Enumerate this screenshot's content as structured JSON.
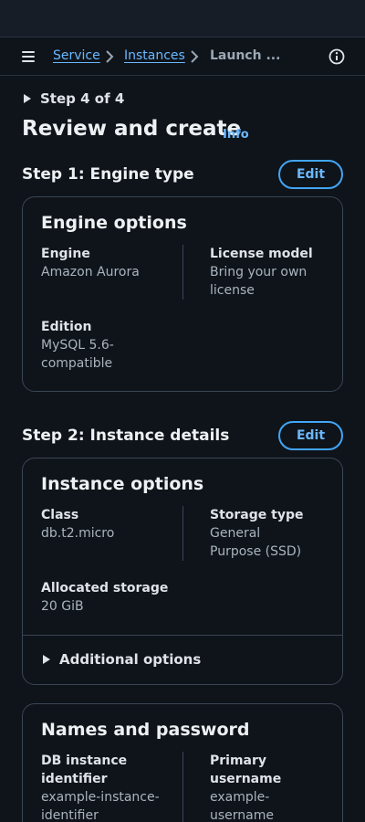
{
  "breadcrumb": {
    "items": [
      "Service",
      "Instances"
    ],
    "current": "Launch ..."
  },
  "wizard": {
    "step_indicator": "Step 4 of 4",
    "title": "Review and create",
    "info_link": "Info"
  },
  "sections": [
    {
      "heading": "Step 1: Engine type",
      "edit_label": "Edit",
      "card_title": "Engine options",
      "fields": [
        {
          "label": "Engine",
          "value": "Amazon Aurora"
        },
        {
          "label": "License model",
          "value": "Bring your own license"
        },
        {
          "label": "Edition",
          "value": "MySQL 5.6-compatible"
        }
      ]
    },
    {
      "heading": "Step 2: Instance details",
      "edit_label": "Edit",
      "card_title": "Instance options",
      "fields": [
        {
          "label": "Class",
          "value": "db.t2.micro"
        },
        {
          "label": "Storage type",
          "value": "General Purpose (SSD)"
        },
        {
          "label": "Allocated storage",
          "value": "20 GiB"
        }
      ],
      "expandable": "Additional options"
    }
  ],
  "names_card": {
    "title": "Names and password",
    "fields": [
      {
        "label": "DB instance identifier",
        "value": "example-instance-identifier"
      },
      {
        "label": "Primary username",
        "value": "example-username"
      }
    ]
  },
  "colors": {
    "background": "#0f141a",
    "link": "#6ab8ff",
    "border": "#3a4553"
  },
  "icons": [
    "menu-icon",
    "chevron-right-icon",
    "info-icon",
    "caret-right-icon"
  ]
}
